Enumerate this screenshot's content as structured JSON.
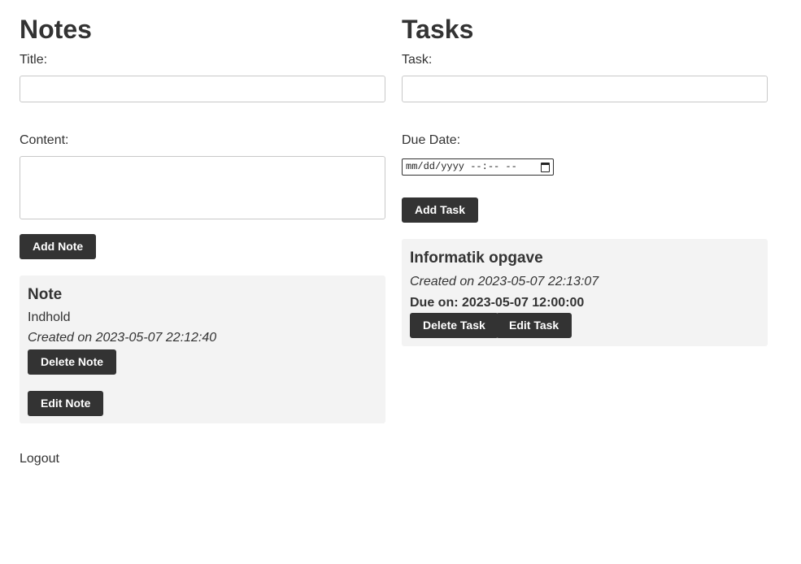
{
  "notes": {
    "heading": "Notes",
    "title_label": "Title:",
    "title_value": "",
    "content_label": "Content:",
    "content_value": "",
    "add_button": "Add Note",
    "items": [
      {
        "title": "Note",
        "content": "Indhold",
        "created": "Created on 2023-05-07 22:12:40",
        "delete_button": "Delete Note",
        "edit_button": "Edit Note"
      }
    ]
  },
  "tasks": {
    "heading": "Tasks",
    "task_label": "Task:",
    "task_value": "",
    "due_label": "Due Date:",
    "due_placeholder": "mm/dd/yyyy --:-- --",
    "add_button": "Add Task",
    "items": [
      {
        "title": "Informatik opgave",
        "created": "Created on 2023-05-07 22:13:07",
        "due": "Due on: 2023-05-07 12:00:00",
        "delete_button": "Delete Task",
        "edit_button": "Edit Task"
      }
    ]
  },
  "logout": "Logout",
  "icons": {
    "date_picker": "calendar-icon"
  },
  "colors": {
    "button_bg": "#333333",
    "card_bg": "#f3f3f3",
    "text": "#333333"
  }
}
